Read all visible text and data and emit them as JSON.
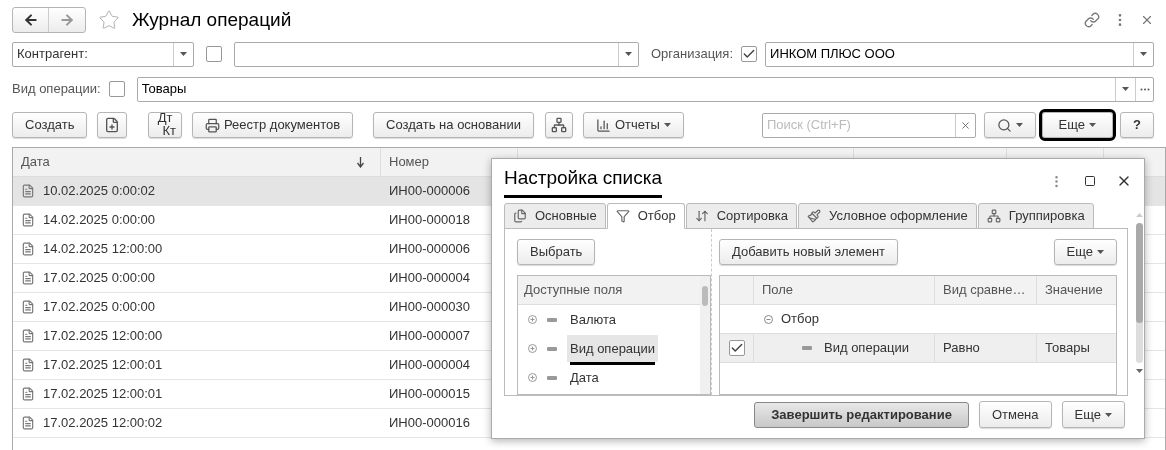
{
  "window": {
    "title": "Журнал операций",
    "favorite": false
  },
  "filters": {
    "counterparty": {
      "selector": "Контрагент:",
      "checked": false
    },
    "organization": {
      "label": "Организация:",
      "checked": true,
      "value": "ИНКОМ ПЛЮС ООО"
    },
    "operation_type": {
      "label": "Вид операции:",
      "checked": false,
      "value": "Товары"
    }
  },
  "toolbar": {
    "create": "Создать",
    "dt": "Дт",
    "kt": "Кт",
    "registry": "Реестр документов",
    "create_based": "Создать на основании",
    "reports": "Отчеты",
    "search_placeholder": "Поиск (Ctrl+F)",
    "more": {
      "label": "Еще",
      "highlighted": true
    },
    "help": "?"
  },
  "table": {
    "columns": [
      {
        "label": "Дата",
        "sorted": true
      },
      {
        "label": "Номер"
      }
    ],
    "rows": [
      {
        "date": "10.02.2025 0:00:02",
        "number": "ИН00-000006",
        "selected": true
      },
      {
        "date": "14.02.2025 0:00:00",
        "number": "ИН00-000018",
        "selected": false
      },
      {
        "date": "14.02.2025 12:00:00",
        "number": "ИН00-000006",
        "selected": false
      },
      {
        "date": "17.02.2025 0:00:00",
        "number": "ИН00-000004",
        "selected": false
      },
      {
        "date": "17.02.2025 0:00:00",
        "number": "ИН00-000030",
        "selected": false
      },
      {
        "date": "17.02.2025 12:00:00",
        "number": "ИН00-000007",
        "selected": false
      },
      {
        "date": "17.02.2025 12:00:01",
        "number": "ИН00-000004",
        "selected": false
      },
      {
        "date": "17.02.2025 12:00:01",
        "number": "ИН00-000015",
        "selected": false
      },
      {
        "date": "17.02.2025 12:00:02",
        "number": "ИН00-000016",
        "selected": false
      }
    ]
  },
  "dialog": {
    "title": "Настройка списка",
    "title_underlined": true,
    "tabs": [
      {
        "label": "Основные",
        "selected": false
      },
      {
        "label": "Отбор",
        "selected": true
      },
      {
        "label": "Сортировка",
        "selected": false
      },
      {
        "label": "Условное оформление",
        "selected": false
      },
      {
        "label": "Группировка",
        "selected": false
      }
    ],
    "select_button": "Выбрать",
    "fields_header": "Доступные поля",
    "fields": [
      {
        "label": "Валюта",
        "selected": false,
        "underlined": false
      },
      {
        "label": "Вид операции",
        "selected": true,
        "underlined": true
      },
      {
        "label": "Дата",
        "selected": false,
        "underlined": false
      }
    ],
    "add_button": "Добавить новый элемент",
    "more_button": "Еще",
    "columns": [
      "Поле",
      "Вид сравне…",
      "Значение"
    ],
    "group": {
      "label": "Отбор",
      "expanded": true,
      "children": [
        {
          "field": "Вид операции",
          "comparison": "Равно",
          "value": "Товары",
          "checked": true,
          "selected": true
        }
      ]
    },
    "finish_button": "Завершить редактирование",
    "cancel_button": "Отмена",
    "footer_more": "Еще"
  }
}
